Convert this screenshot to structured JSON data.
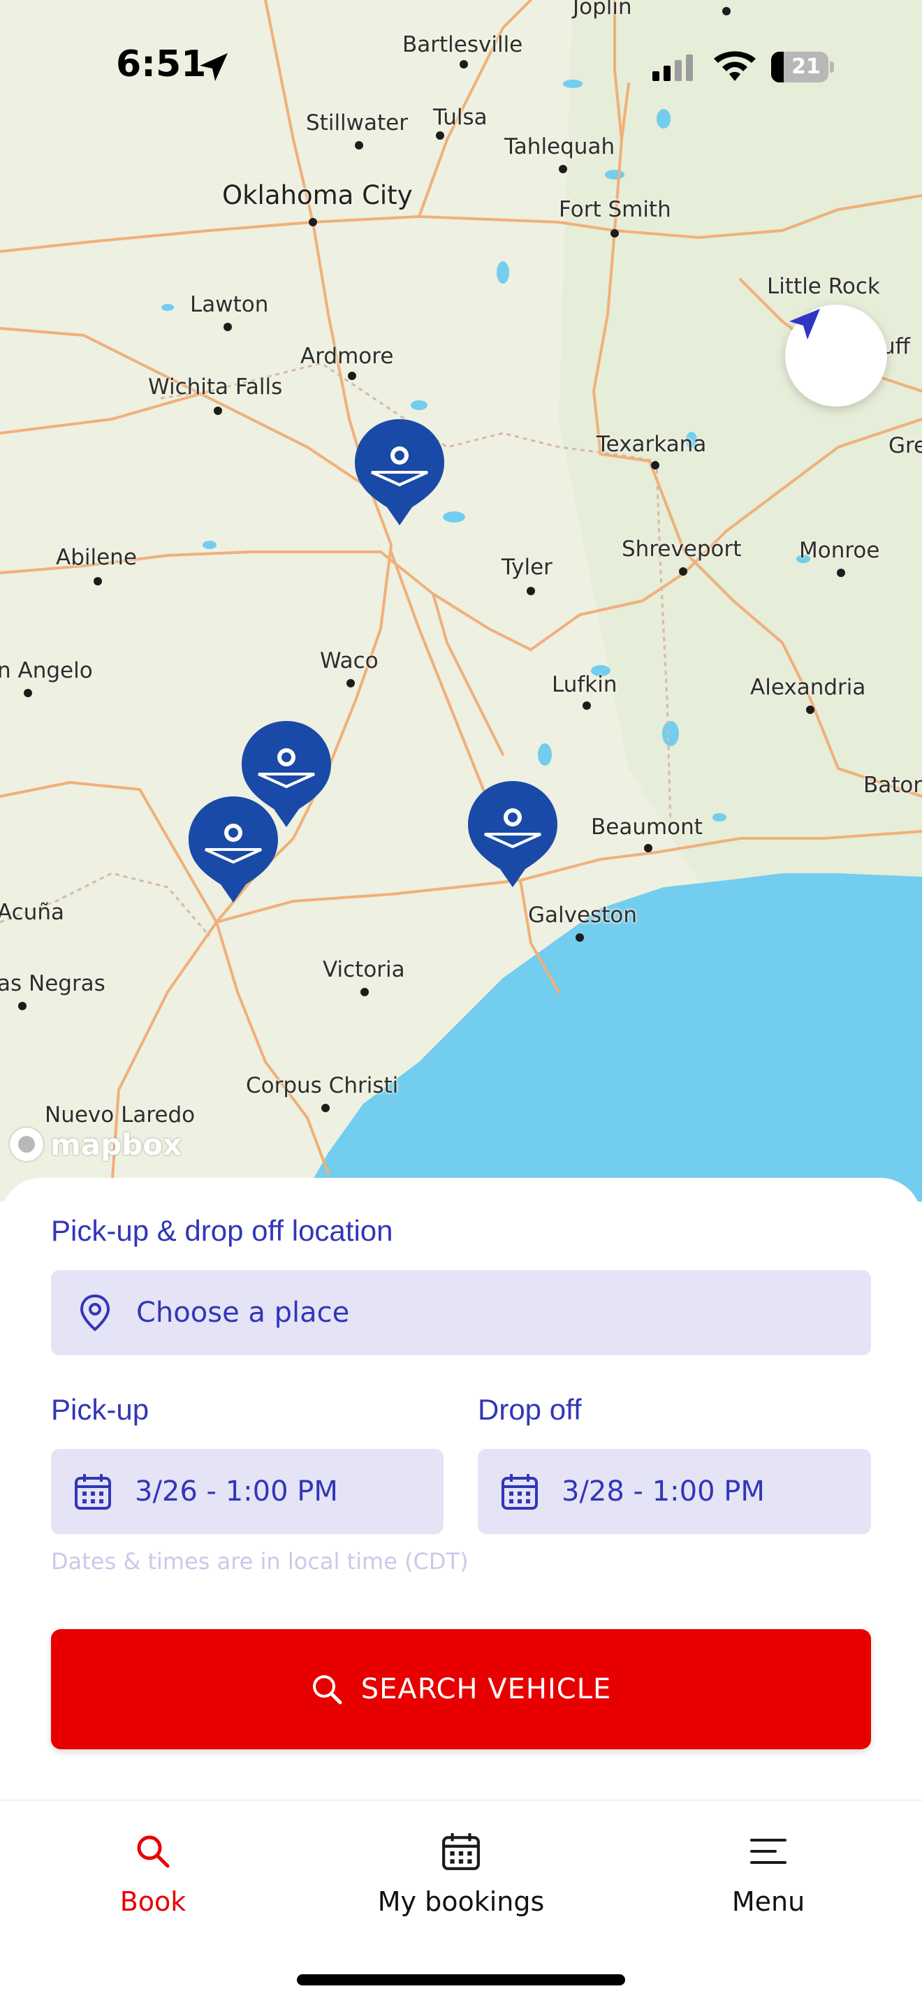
{
  "status_bar": {
    "time": "6:51",
    "battery": "21"
  },
  "map": {
    "attribution": "mapbox",
    "cities": [
      {
        "name": "Joplin"
      },
      {
        "name": "Bartlesville"
      },
      {
        "name": "Stillwater"
      },
      {
        "name": "Tulsa"
      },
      {
        "name": "Tahlequah"
      },
      {
        "name": "Oklahoma City"
      },
      {
        "name": "Fort Smith"
      },
      {
        "name": "Little Rock"
      },
      {
        "name": "Lawton"
      },
      {
        "name": "Ardmore"
      },
      {
        "name": "Wichita Falls"
      },
      {
        "name": "Texarkana"
      },
      {
        "name": "Abilene"
      },
      {
        "name": "Tyler"
      },
      {
        "name": "Shreveport"
      },
      {
        "name": "Monroe"
      },
      {
        "name": "n Angelo"
      },
      {
        "name": "Waco"
      },
      {
        "name": "Lufkin"
      },
      {
        "name": "Alexandria"
      },
      {
        "name": "Beaumont"
      },
      {
        "name": "Baton"
      },
      {
        "name": "Acuña"
      },
      {
        "name": "Galveston"
      },
      {
        "name": "Victoria"
      },
      {
        "name": "as Negras"
      },
      {
        "name": "Corpus Christi"
      },
      {
        "name": "Nuevo Laredo"
      },
      {
        "name": "uff"
      },
      {
        "name": "Gre"
      }
    ],
    "pins": [
      "Dallas area",
      "Austin area",
      "San Antonio area",
      "Houston area"
    ]
  },
  "booking": {
    "location_label": "Pick-up & drop off location",
    "location_placeholder": "Choose a place",
    "pickup_label": "Pick-up",
    "pickup_value": "3/26 - 1:00 PM",
    "dropoff_label": "Drop off",
    "dropoff_value": "3/28 - 1:00 PM",
    "timezone_hint": "Dates & times are in local time (CDT)",
    "search_button": "SEARCH VEHICLE"
  },
  "tabs": [
    {
      "label": "Book",
      "icon": "search-icon",
      "active": true
    },
    {
      "label": "My bookings",
      "icon": "calendar-icon",
      "active": false
    },
    {
      "label": "Menu",
      "icon": "menu-icon",
      "active": false
    }
  ],
  "colors": {
    "accent": "#3236b8",
    "primary_button": "#e80000",
    "active_tab": "#e80000",
    "pin": "#1a4aa8",
    "water": "#72cdee",
    "field_bg": "#e4e4f6"
  }
}
